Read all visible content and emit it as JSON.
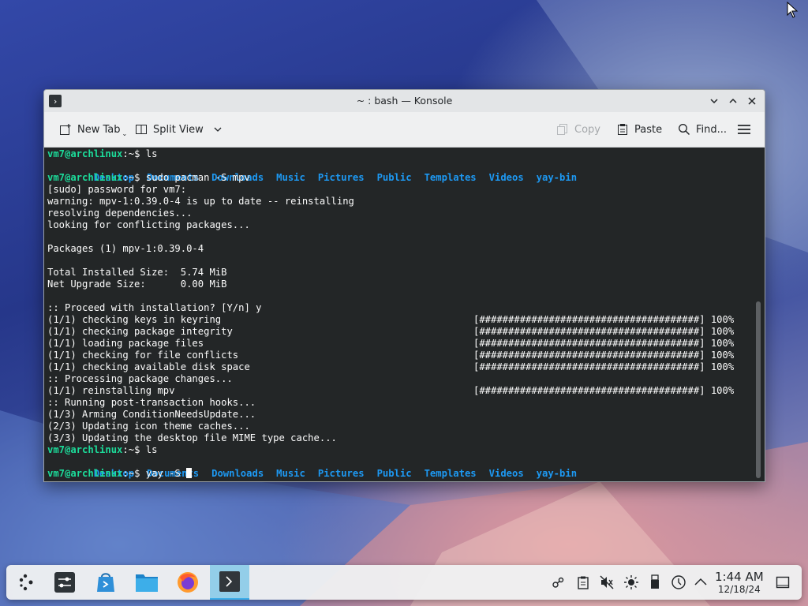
{
  "window": {
    "title": "~ : bash — Konsole"
  },
  "toolbar": {
    "new_tab": "New Tab",
    "split_view": "Split View",
    "copy": "Copy",
    "paste": "Paste",
    "find": "Find..."
  },
  "terminal": {
    "prompt": "vm7@archlinux",
    "prompt_suffix": ":~$ ",
    "cmd1": "ls",
    "dirs": [
      "Desktop",
      "Documents",
      "Downloads",
      "Music",
      "Pictures",
      "Public",
      "Templates",
      "Videos",
      "yay-bin"
    ],
    "cmd2": "sudo pacman -S mpv",
    "out": [
      "[sudo] password for vm7:",
      "warning: mpv-1:0.39.0-4 is up to date -- reinstalling",
      "resolving dependencies...",
      "looking for conflicting packages...",
      "",
      "Packages (1) mpv-1:0.39.0-4",
      "",
      "Total Installed Size:  5.74 MiB",
      "Net Upgrade Size:      0.00 MiB",
      "",
      ":: Proceed with installation? [Y/n] y"
    ],
    "progress_lines": [
      "(1/1) checking keys in keyring",
      "(1/1) checking package integrity",
      "(1/1) loading package files",
      "(1/1) checking for file conflicts",
      "(1/1) checking available disk space"
    ],
    "processing": ":: Processing package changes...",
    "reinstalling": "(1/1) reinstalling mpv",
    "progress_bar": "[######################################] 100%",
    "hooks": [
      ":: Running post-transaction hooks...",
      "(1/3) Arming ConditionNeedsUpdate...",
      "(2/3) Updating icon theme caches...",
      "(3/3) Updating the desktop file MIME type cache..."
    ],
    "cmd3": "ls",
    "cmd4": "yay -S "
  },
  "clock": {
    "time": "1:44 AM",
    "date": "12/18/24"
  }
}
